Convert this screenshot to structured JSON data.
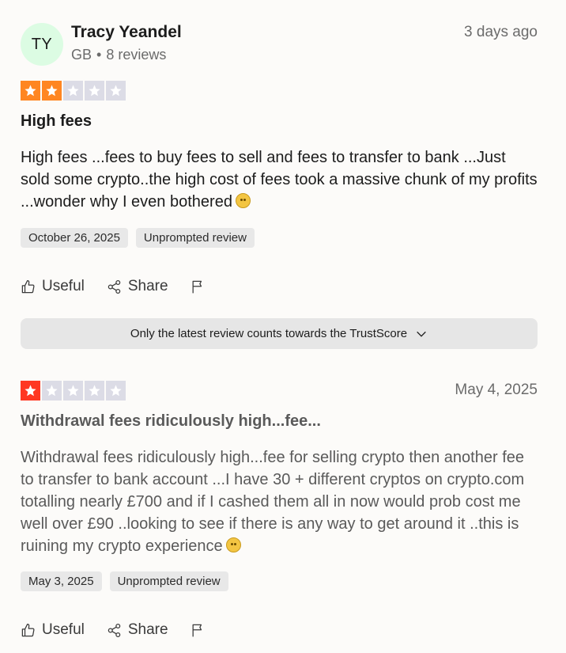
{
  "colors": {
    "avatar_bg": "#dcfce3",
    "star_orange": "#ff8622",
    "star_red": "#ff3722",
    "star_empty": "#dcdce6",
    "tag_bg": "#e8e8e8"
  },
  "review1": {
    "avatar_initials": "TY",
    "reviewer_name": "Tracy Yeandel",
    "country": "GB",
    "separator": "•",
    "reviews_count": "8 reviews",
    "posted": "3 days ago",
    "rating": 2,
    "title": "High fees",
    "body": "High fees ...fees to buy fees to sell and fees to transfer to bank ...Just sold some crypto..the high cost of fees took a massive chunk of my profits ...wonder why I even bothered",
    "emoji": "face-with-monocle",
    "experience_date": "October 26, 2025",
    "tag": "Unprompted review",
    "useful_label": "Useful",
    "share_label": "Share"
  },
  "notice": {
    "text": "Only the latest review counts towards the TrustScore"
  },
  "review2": {
    "posted": "May 4, 2025",
    "rating": 1,
    "title": "Withdrawal fees ridiculously high...fee...",
    "body": "Withdrawal fees ridiculously high...fee for selling crypto then another fee to transfer to bank account ...I have 30 + different cryptos on crypto.com totalling nearly £700 and if I cashed them all in now would prob cost me well over £90 ..looking to see if there is any way to get around it ..this is ruining my crypto experience",
    "emoji": "thinking-face",
    "experience_date": "May 3, 2025",
    "tag": "Unprompted review",
    "useful_label": "Useful",
    "share_label": "Share"
  }
}
